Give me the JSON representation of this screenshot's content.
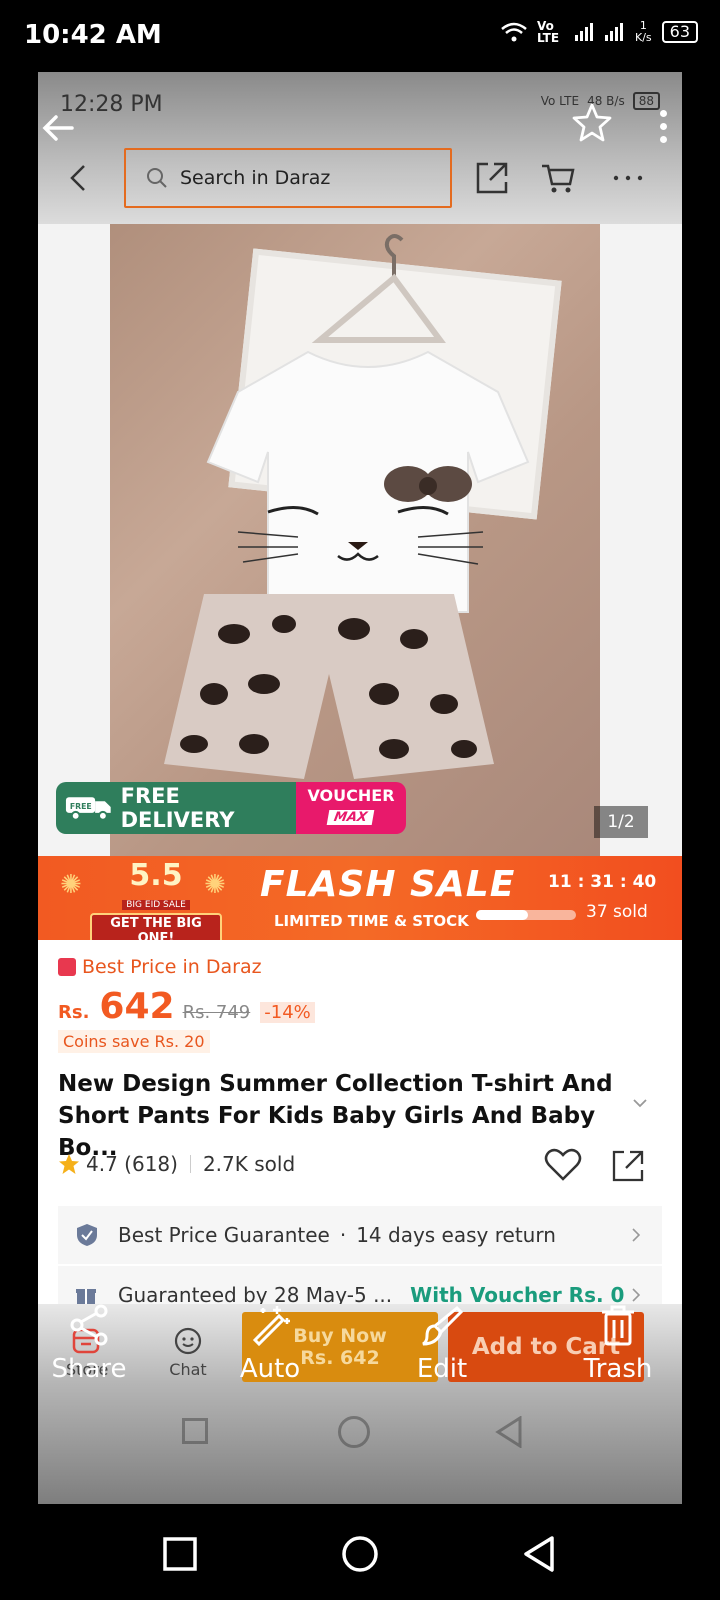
{
  "os_status": {
    "time": "10:42 AM",
    "net": "Vo LTE",
    "speed_num": "1",
    "speed_unit": "K/s",
    "battery": "63"
  },
  "viewer": {
    "inner_status": {
      "time": "12:28 PM",
      "net": "Vo LTE",
      "speed": "48 B/s",
      "battery": "88"
    }
  },
  "app_header": {
    "search_placeholder": "Search in Daraz"
  },
  "hero": {
    "free_delivery": "FREE DELIVERY",
    "free_tag": "FREE",
    "voucher_line1": "VOUCHER",
    "voucher_line2": "MAX",
    "image_counter": "1/2"
  },
  "flash_sale": {
    "event_number": "5.5",
    "event_small": "BIG EID SALE",
    "event_button": "GET THE BIG ONE!",
    "title": "FLASH SALE",
    "subtitle": "LIMITED TIME & STOCK",
    "timer": "11 : 31 : 40",
    "sold": "37 sold",
    "sold_progress": 0.52
  },
  "product": {
    "best_price": "Best Price in Daraz",
    "currency": "Rs.",
    "price": "642",
    "old_price": "Rs. 749",
    "discount": "-14%",
    "coins": "Coins save Rs. 20",
    "title": "New Design Summer Collection T-shirt And Short Pants For Kids Baby Girls And Baby Bo...",
    "rating": "4.7 (618)",
    "sold": "2.7K sold",
    "guarantee_line1_a": "Best Price Guarantee",
    "guarantee_line1_b": "14 days easy return",
    "guarantee_line2_a": "Guaranteed by 28 May-5 ...",
    "guarantee_line2_b": "With Voucher Rs. 0"
  },
  "action_bar": {
    "store": "Store",
    "chat": "Chat",
    "buy_now_1": "Buy Now",
    "buy_now_2": "Rs. 642",
    "add_to_cart": "Add to Cart"
  },
  "editor_tools": {
    "share": "Share",
    "auto": "Auto",
    "edit": "Edit",
    "trash": "Trash"
  },
  "colors": {
    "accent": "#f25a22",
    "free_green": "#2f7e5c",
    "voucher_pink": "#e8196b",
    "link_green": "#1a9c7d"
  }
}
